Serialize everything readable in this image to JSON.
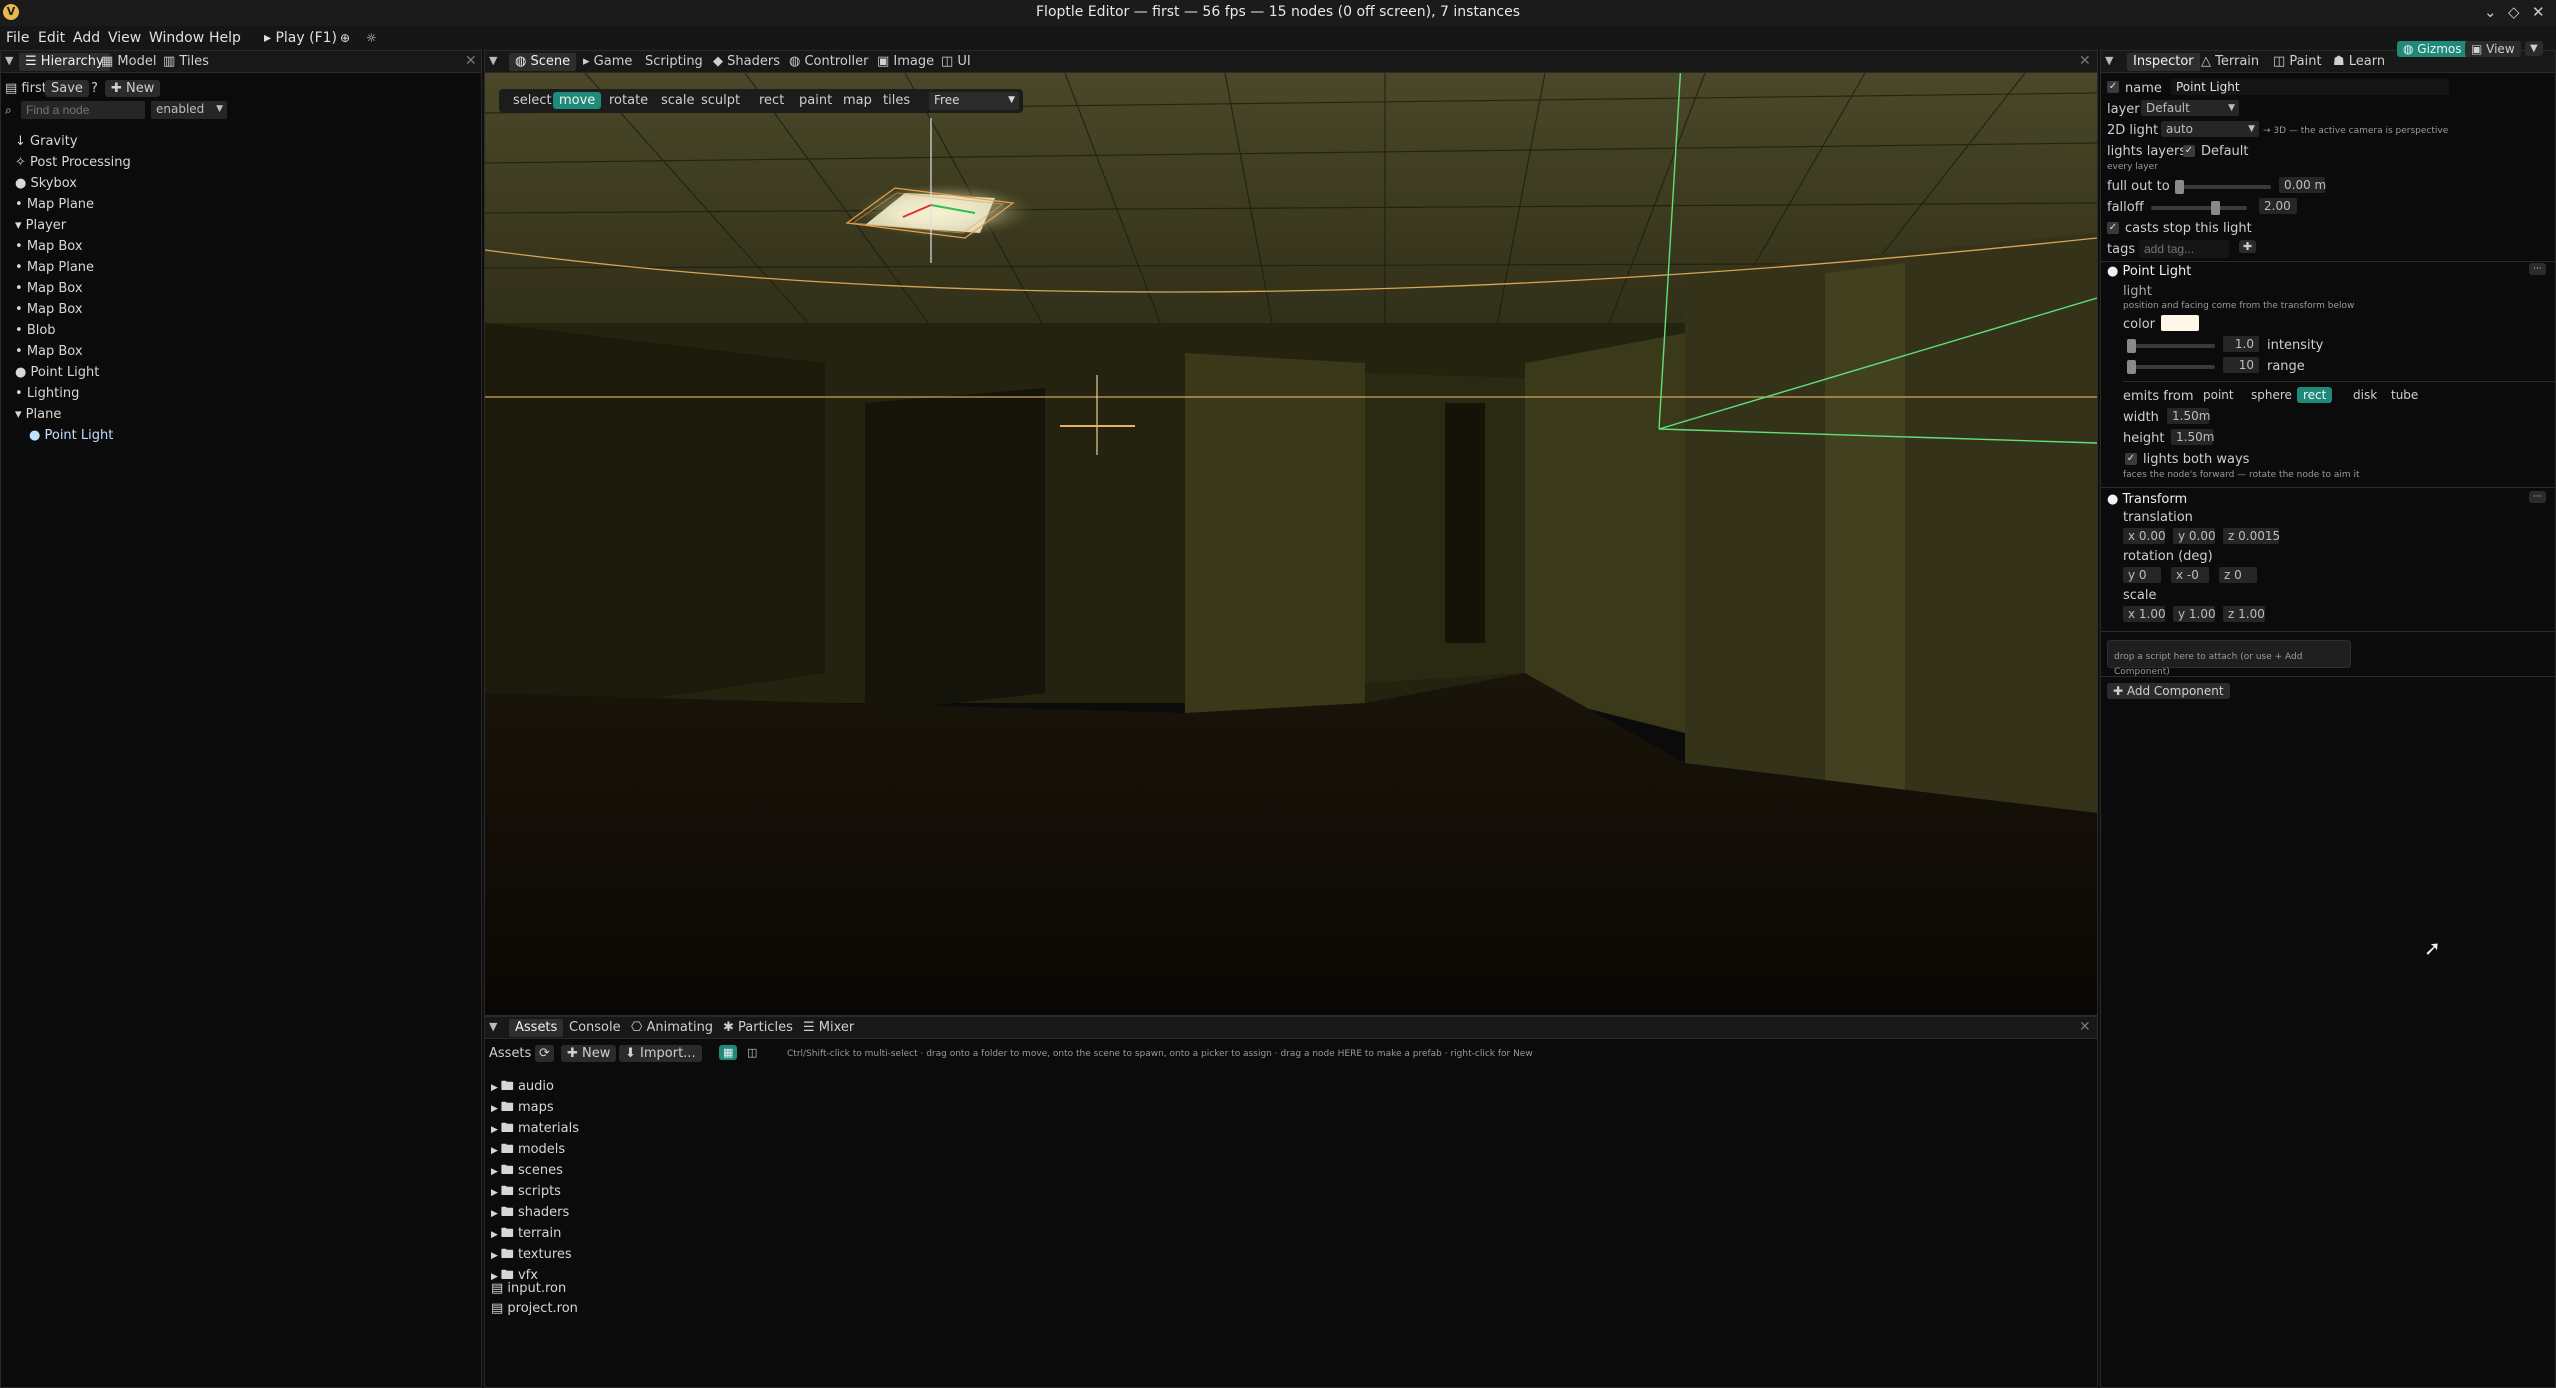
{
  "window": {
    "title": "Floptle Editor — first — 56 fps — 15 nodes (0 off screen), 7 instances",
    "controls": [
      "⌄",
      "◇",
      "✕"
    ]
  },
  "menu": {
    "items": [
      "File",
      "Edit",
      "Add",
      "View",
      "Window",
      "Help"
    ],
    "play": "▸ Play (F1)"
  },
  "hierarchy": {
    "tabs": [
      "Hierarchy",
      "Model",
      "Tiles"
    ],
    "scene_name": "first",
    "save_label": "Save",
    "help_label": "?",
    "new_label": "New",
    "search_placeholder": "Find a node",
    "filter_value": "enabled",
    "nodes": [
      {
        "label": "Gravity",
        "prefix": "↓"
      },
      {
        "label": "Post Processing",
        "prefix": "✧"
      },
      {
        "label": "Skybox",
        "prefix": "●"
      },
      {
        "label": "Map Plane",
        "prefix": "•"
      },
      {
        "label": "Player",
        "prefix": "▾"
      },
      {
        "label": "Map Box",
        "prefix": "•"
      },
      {
        "label": "Map Plane",
        "prefix": "•"
      },
      {
        "label": "Map Box",
        "prefix": "•"
      },
      {
        "label": "Map Box",
        "prefix": "•"
      },
      {
        "label": "Blob",
        "prefix": "•"
      },
      {
        "label": "Map Box",
        "prefix": "•"
      },
      {
        "label": "Point Light",
        "prefix": "●"
      },
      {
        "label": "Lighting",
        "prefix": "•"
      },
      {
        "label": "Plane",
        "prefix": "▾"
      },
      {
        "label": "Point Light",
        "prefix": "●"
      }
    ]
  },
  "viewport": {
    "tabs": [
      "Scene",
      "Game",
      "Scripting",
      "Shaders",
      "Controller",
      "Image",
      "UI"
    ],
    "tools": [
      "select",
      "move",
      "rotate",
      "scale",
      "sculpt",
      "rect",
      "paint",
      "map",
      "tiles"
    ],
    "active_tool": "move",
    "camera_mode": "Free"
  },
  "bottom": {
    "tabs": [
      "Assets",
      "Console",
      "Animating",
      "Particles",
      "Mixer"
    ],
    "assets_label": "Assets",
    "new_label": "New",
    "import_label": "Import...",
    "hint": "Ctrl/Shift-click to multi-select · drag onto a folder to move, onto the scene to spawn, onto a picker to assign · drag a node HERE to make a prefab · right-click for New",
    "folders": [
      "audio",
      "maps",
      "materials",
      "models",
      "scenes",
      "scripts",
      "shaders",
      "terrain",
      "textures",
      "vfx"
    ],
    "files": [
      "input.ron",
      "project.ron"
    ]
  },
  "inspector": {
    "tabs": [
      "Inspector",
      "Terrain",
      "Paint",
      "Learn"
    ],
    "gizmos_label": "Gizmos",
    "view_label": "View",
    "name_label": "name",
    "name_value": "Point Light",
    "layer_label": "layer",
    "layer_value": "Default",
    "light2d_label": "2D light",
    "light2d_value": "auto",
    "light2d_hint": "→ 3D — the active camera is perspective",
    "lights_layers_label": "lights layers",
    "lights_layers_value": "Default",
    "every_layer_hint": "every layer",
    "fullout_label": "full out to",
    "fullout_value": "0.00 m",
    "falloff_label": "falloff",
    "falloff_value": "2.00",
    "casts_stop_label": "casts stop this light",
    "tags_label": "tags",
    "tags_placeholder": "add tag...",
    "point_light_section": "Point Light",
    "light_label": "light",
    "light_hint": "position and facing come from the transform below",
    "color_label": "color",
    "intensity_value": "1.0",
    "intensity_label": "intensity",
    "range_value": "10",
    "range_label": "range",
    "emits_from_label": "emits from",
    "emit_options": [
      "point",
      "sphere",
      "rect",
      "disk",
      "tube"
    ],
    "emit_selected": "rect",
    "width_label": "width",
    "width_value": "1.50m",
    "height_label": "height",
    "height_value": "1.50m",
    "both_ways_label": "lights both ways",
    "both_ways_hint": "faces the node's forward — rotate the node to aim it",
    "transform_section": "Transform",
    "translation_label": "translation",
    "translation": [
      "x 0.00",
      "y 0.00",
      "z 0.0015"
    ],
    "rotation_label": "rotation (deg)",
    "rotation": [
      "y 0",
      "x -0",
      "z 0"
    ],
    "scale_label": "scale",
    "scale": [
      "x 1.00",
      "y 1.00",
      "z 1.00"
    ],
    "drop_script_hint": "drop a script here to attach (or use + Add Component)",
    "add_component_label": "Add Component",
    "more_label": "···"
  },
  "colors": {
    "accent": "#1f8a7a",
    "gizmo_green": "#5fe07a",
    "gizmo_orange": "#e8b060",
    "light_color": "#fff8e8"
  }
}
